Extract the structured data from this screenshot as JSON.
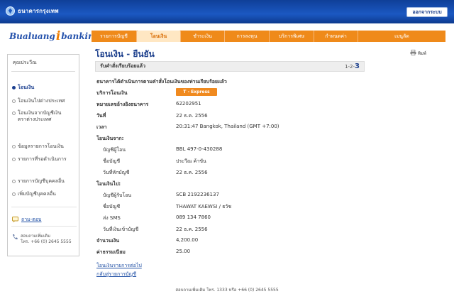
{
  "header": {
    "bank_name": "ธนาคารกรุงเทพ",
    "logout_label": "ออกจากระบบ"
  },
  "brand": {
    "part1": "Bualuang",
    "part_i": "i",
    "part2": "banking"
  },
  "nav": {
    "tabs": [
      {
        "label": "รายการบัญชี",
        "active": false
      },
      {
        "label": "โอนเงิน",
        "active": true
      },
      {
        "label": "ชำระเงิน",
        "active": false
      },
      {
        "label": "การลงทุน",
        "active": false
      },
      {
        "label": "บริการพิเศษ",
        "active": false
      },
      {
        "label": "กำหนดค่า",
        "active": false
      },
      {
        "label": "เมนูลัด",
        "active": false
      }
    ]
  },
  "sidebar": {
    "heading": "คุณประวีณ",
    "items": [
      {
        "label": "โอนเงิน",
        "active": true
      },
      {
        "label": "โอนเงินไปต่างประเทศ",
        "active": false
      },
      {
        "label": "โอนเงินจากบัญชีเงินตราต่างประเทศ",
        "active": false
      },
      {
        "label": "ข้อมูลรายการโอนเงิน",
        "active": false
      },
      {
        "label": "รายการที่รอดำเนินการ",
        "active": false
      },
      {
        "label": "รายการบัญชีบุคคลอื่น",
        "active": false
      },
      {
        "label": "เพิ่มบัญชีบุคคลอื่น",
        "active": false
      }
    ],
    "help_label": "ถาม-ตอบ",
    "contact_line1": "สอบถามเพิ่มเติม",
    "contact_line2": "โทร. +66 (0) 2645 5555"
  },
  "main": {
    "title": "โอนเงิน - ยืนยัน",
    "print_label": "พิมพ์",
    "status_text": "รับคำสั่งเรียบร้อยแล้ว",
    "steps_prefix": "1-2-",
    "steps_current": "3",
    "notice": "ธนาคารได้ดำเนินการตามคำสั่งโอนเงินของท่านเรียบร้อยแล้ว",
    "service_label": "บริการโอนเงิน",
    "service_value": "T - Express",
    "ref_label": "หมายเลขอ้างอิงธนาคาร",
    "ref_value": "62202951",
    "date_label": "วันที่",
    "date_value": "22 ธ.ค. 2556",
    "time_label": "เวลา",
    "time_value": "20:31:47 Bangkok, Thailand (GMT +7:00)",
    "from_heading": "โอนเงินจาก:",
    "from_account_label": "บัญชีผู้โอน",
    "from_account_value": "BBL 497-0-430288",
    "from_name_label": "ชื่อบัญชี",
    "from_name_value": "ประวีณ ค้าขัน",
    "from_debit_label": "วันที่หักบัญชี",
    "from_debit_value": "22 ธ.ค. 2556",
    "to_heading": "โอนเงินไป:",
    "to_account_label": "บัญชีผู้รับโอน",
    "to_account_value": "SCB 2192236137",
    "to_name_label": "ชื่อบัญชี",
    "to_name_value": "THAWAT KAEWSI / ธวัช",
    "sms_label": "ส่ง SMS",
    "sms_value": "089 134 7860",
    "to_credit_label": "วันที่เงินเข้าบัญชี",
    "to_credit_value": "22 ธ.ค. 2556",
    "amount_label": "จำนวนเงิน",
    "amount_value": "4,200.00",
    "fee_label": "ค่าธรรมเนียม",
    "fee_value": "25.00",
    "link_again": "โอนเงินรายการต่อไป",
    "link_back": "กลับสู่รายการบัญชี"
  },
  "footer": {
    "text": "สอบถามเพิ่มเติม โทร. 1333 หรือ +66 (0) 2645 5555"
  },
  "colors": {
    "header_blue": "#1b58c2",
    "nav_orange": "#ef8a1a",
    "link_blue": "#1f4fa5",
    "title_blue": "#1c3f8c"
  }
}
